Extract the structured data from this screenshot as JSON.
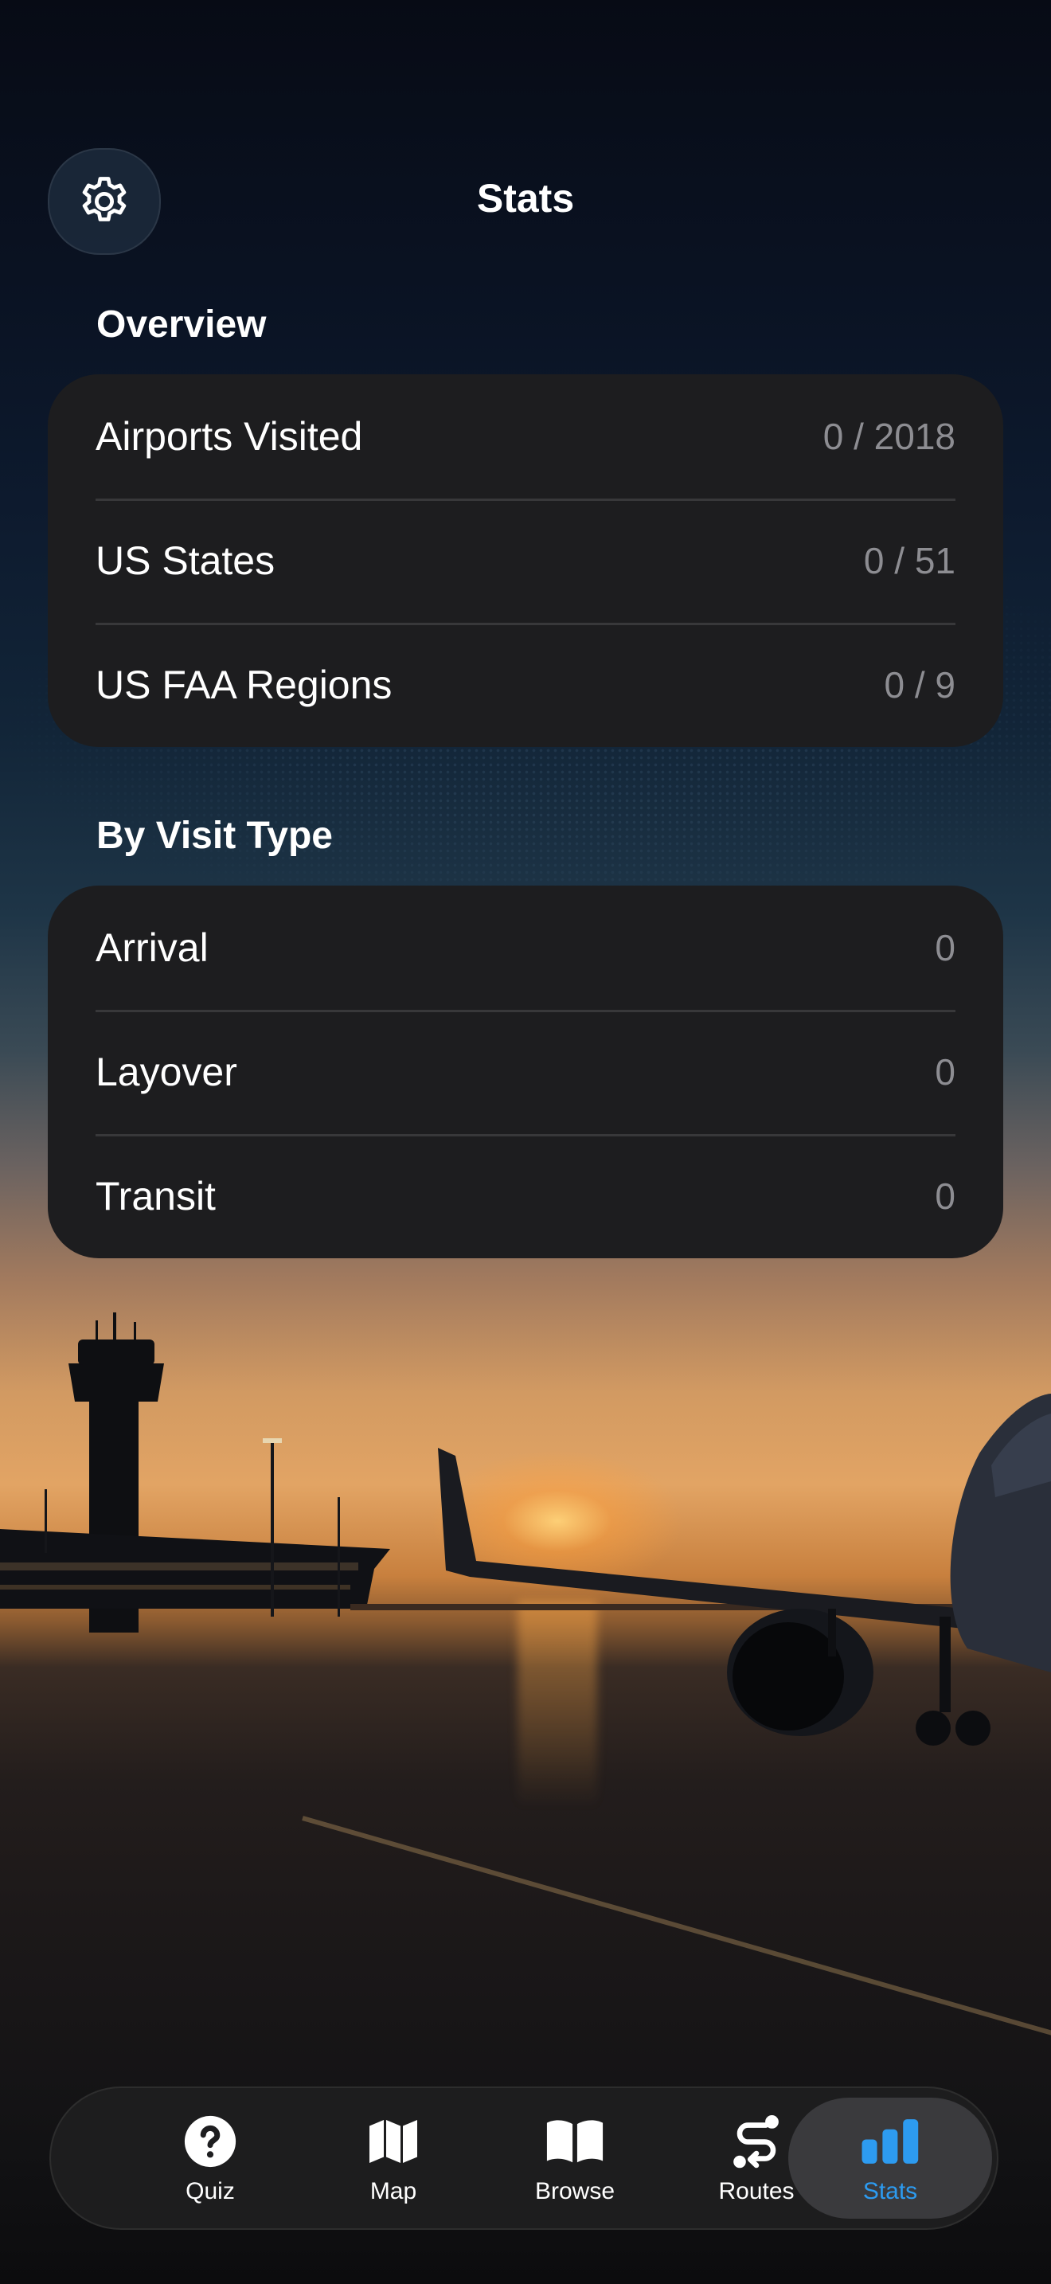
{
  "header": {
    "title": "Stats",
    "settings_icon": "gear-icon"
  },
  "overview": {
    "title": "Overview",
    "rows": [
      {
        "label": "Airports Visited",
        "value": "0 / 2018"
      },
      {
        "label": "US States",
        "value": "0 / 51"
      },
      {
        "label": "US FAA Regions",
        "value": "0 / 9"
      }
    ]
  },
  "by_visit_type": {
    "title": "By Visit Type",
    "rows": [
      {
        "label": "Arrival",
        "value": "0"
      },
      {
        "label": "Layover",
        "value": "0"
      },
      {
        "label": "Transit",
        "value": "0"
      }
    ]
  },
  "tab_bar": {
    "active": "Stats",
    "accent_color": "#2d9bf0",
    "tabs": [
      {
        "label": "Quiz",
        "icon": "question-circle-icon"
      },
      {
        "label": "Map",
        "icon": "map-icon"
      },
      {
        "label": "Browse",
        "icon": "book-icon"
      },
      {
        "label": "Routes",
        "icon": "route-icon"
      },
      {
        "label": "Stats",
        "icon": "bar-chart-icon"
      }
    ]
  }
}
